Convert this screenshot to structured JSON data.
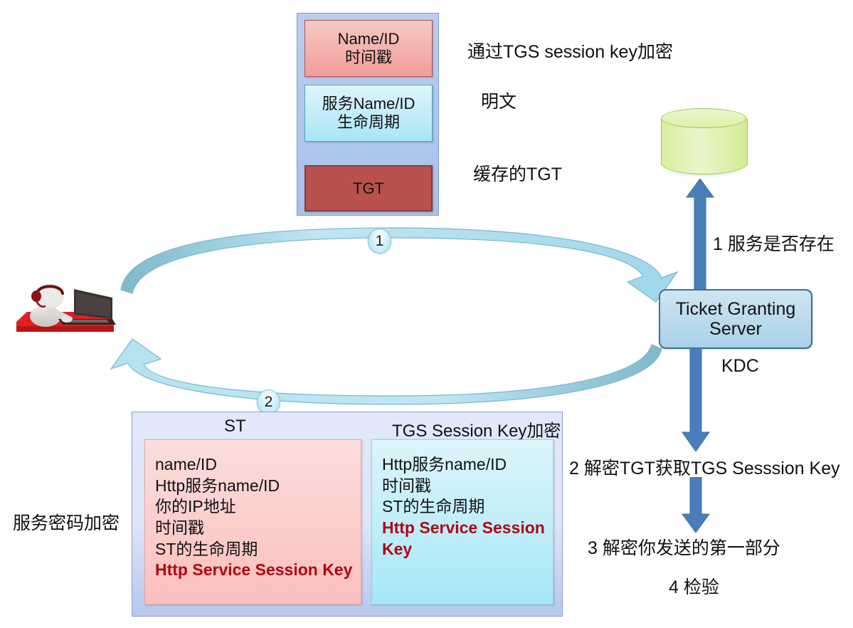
{
  "top_packet": {
    "name_id_block": "Name/ID\n时间戳",
    "name_id_line1": "Name/ID",
    "name_id_line2": "时间戳",
    "service_line1": "服务Name/ID",
    "service_line2": "生命周期",
    "tgt_label": "TGT"
  },
  "annotations": {
    "encrypted_with_tgs_session_key": "通过TGS session key加密",
    "plaintext": "明文",
    "cached_tgt": "缓存的TGT"
  },
  "server": {
    "tgs_line1": "Ticket Granting",
    "tgs_line2": "Server",
    "kdc_label": "KDC"
  },
  "steps": {
    "step1": "1 服务是否存在",
    "step2": "2 解密TGT获取TGS Sesssion Key",
    "step3": "3 解密你发送的第一部分",
    "step4": "4 检验"
  },
  "badges": {
    "one": "1",
    "two": "2"
  },
  "left_label": "服务密码加密",
  "bottom_packet": {
    "st_title": "ST",
    "tgs_title": "TGS Session Key加密",
    "st_lines": [
      "name/ID",
      "Http服务name/ID",
      "你的IP地址",
      "时间戳",
      "ST的生命周期"
    ],
    "st_highlight": "Http Service Session Key",
    "tgs_lines": [
      "Http服务name/ID",
      "时间戳",
      "ST的生命周期"
    ],
    "tgs_highlight": "Http Service Session Key"
  },
  "colors": {
    "packet_blue": "#aac4ec",
    "name_red": "#f29d99",
    "service_cyan": "#a8e6f5",
    "tgt_dark_red": "#b8514d",
    "arrow_blue": "#4a7ebb",
    "cycle_cyan": "#a9dcec",
    "tgs_box_blue": "#a9d2e8",
    "db_green": "#d8ee9e",
    "highlight_red": "#b00711"
  }
}
